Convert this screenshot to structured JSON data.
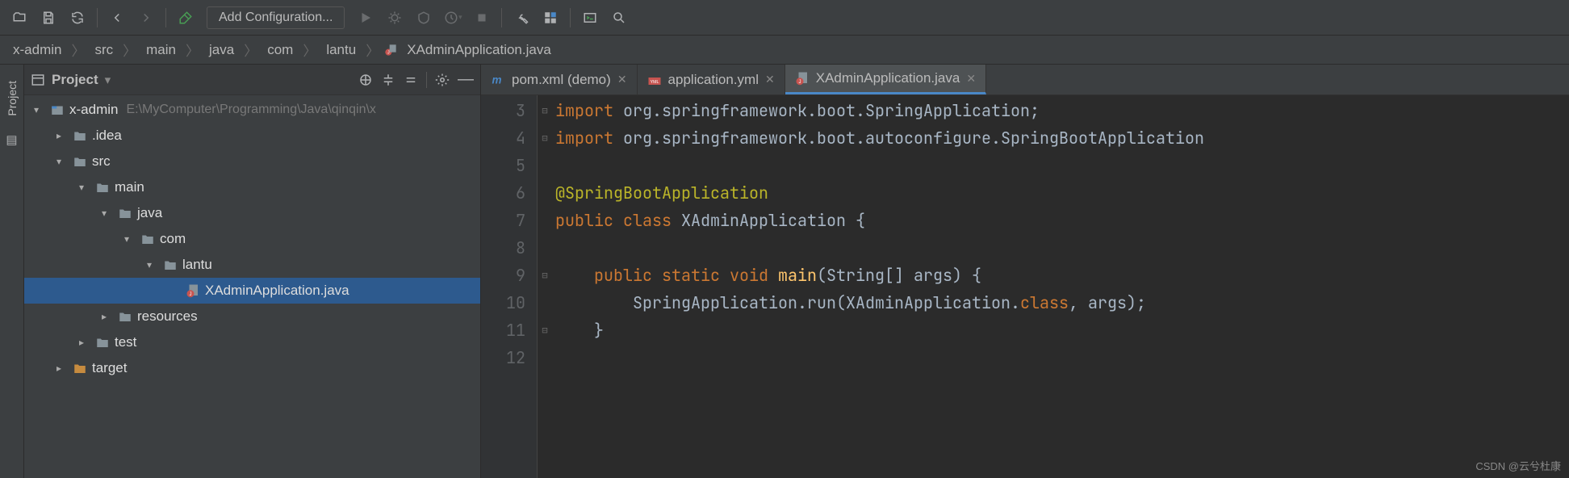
{
  "toolbar": {
    "config_label": "Add Configuration..."
  },
  "breadcrumb": [
    "x-admin",
    "src",
    "main",
    "java",
    "com",
    "lantu",
    "XAdminApplication.java"
  ],
  "project_panel": {
    "title": "Project",
    "tree": [
      {
        "depth": 0,
        "arrow": "down",
        "icon": "module",
        "label": "x-admin",
        "hint": "E:\\MyComputer\\Programming\\Java\\qinqin\\x",
        "selected": false
      },
      {
        "depth": 1,
        "arrow": "right",
        "icon": "folder",
        "label": ".idea",
        "hint": "",
        "selected": false
      },
      {
        "depth": 1,
        "arrow": "down",
        "icon": "folder",
        "label": "src",
        "hint": "",
        "selected": false
      },
      {
        "depth": 2,
        "arrow": "down",
        "icon": "folder",
        "label": "main",
        "hint": "",
        "selected": false
      },
      {
        "depth": 3,
        "arrow": "down",
        "icon": "folder",
        "label": "java",
        "hint": "",
        "selected": false
      },
      {
        "depth": 4,
        "arrow": "down",
        "icon": "folder",
        "label": "com",
        "hint": "",
        "selected": false
      },
      {
        "depth": 5,
        "arrow": "down",
        "icon": "folder",
        "label": "lantu",
        "hint": "",
        "selected": false
      },
      {
        "depth": 6,
        "arrow": "",
        "icon": "java",
        "label": "XAdminApplication.java",
        "hint": "",
        "selected": true
      },
      {
        "depth": 3,
        "arrow": "right",
        "icon": "folder",
        "label": "resources",
        "hint": "",
        "selected": false
      },
      {
        "depth": 2,
        "arrow": "right",
        "icon": "folder",
        "label": "test",
        "hint": "",
        "selected": false
      },
      {
        "depth": 1,
        "arrow": "right",
        "icon": "folder-orange",
        "label": "target",
        "hint": "",
        "selected": false
      }
    ]
  },
  "tabs": [
    {
      "icon": "maven",
      "label": "pom.xml (demo)",
      "active": false
    },
    {
      "icon": "yml",
      "label": "application.yml",
      "active": false
    },
    {
      "icon": "java",
      "label": "XAdminApplication.java",
      "active": true
    }
  ],
  "editor": {
    "first_line": 3,
    "lines": [
      {
        "n": 3,
        "fold": "-",
        "html": "<span class='kw'>import</span> <span class='pkg'>org.springframework.boot.SpringApplication;</span>"
      },
      {
        "n": 4,
        "fold": "-",
        "html": "<span class='kw'>import</span> <span class='pkg'>org.springframework.boot.autoconfigure.SpringBootApplication</span>"
      },
      {
        "n": 5,
        "fold": "",
        "html": ""
      },
      {
        "n": 6,
        "fold": "",
        "html": "<span class='ann'>@SpringBootApplication</span>"
      },
      {
        "n": 7,
        "fold": "",
        "html": "<span class='kw'>public class</span> XAdminApplication {"
      },
      {
        "n": 8,
        "fold": "",
        "html": ""
      },
      {
        "n": 9,
        "fold": "-",
        "html": "    <span class='kw'>public static void</span> <span class='fn'>main</span>(String[] args) {"
      },
      {
        "n": 10,
        "fold": "",
        "html": "        SpringApplication.run(XAdminApplication.<span class='kw'>class</span>, args);"
      },
      {
        "n": 11,
        "fold": "-",
        "html": "    }"
      },
      {
        "n": 12,
        "fold": "",
        "html": ""
      }
    ]
  },
  "left_strip": {
    "label": "Project"
  },
  "watermark": "CSDN @云兮杜康"
}
